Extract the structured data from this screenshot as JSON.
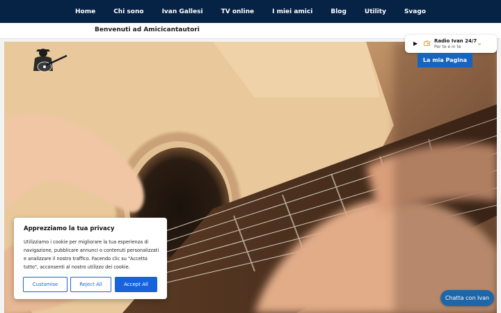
{
  "nav": {
    "items": [
      "Home",
      "Chi sono",
      "Ivan Gallesi",
      "TV online",
      "I miei amici",
      "Blog",
      "Utility",
      "Svago"
    ]
  },
  "welcome": {
    "text": "Benvenuti ad Amicicantautori"
  },
  "radio": {
    "play_icon": "play-icon",
    "title": "Radio Ivan 24/7",
    "subtitle": "Per te e in te"
  },
  "my_page_button": "La mia Pagina",
  "cookie": {
    "title": "Apprezziamo la tua privacy",
    "body": "Utilizziamo i cookie per migliorare la tua esperienza di navigazione, pubblicare annunci o contenuti personalizzati e analizzare il nostro traffico. Facendo clic su \"Accetta tutto\", acconsenti al nostro utilizzo dei cookie.",
    "customise": "Customise",
    "reject": "Reject All",
    "accept": "Accept All"
  },
  "chat_button": "Chatta con Ivan",
  "colors": {
    "nav_bg": "#062346",
    "accent": "#1863dc",
    "my_page_bg": "#1565c0",
    "chat_bg": "#1f66a8"
  }
}
